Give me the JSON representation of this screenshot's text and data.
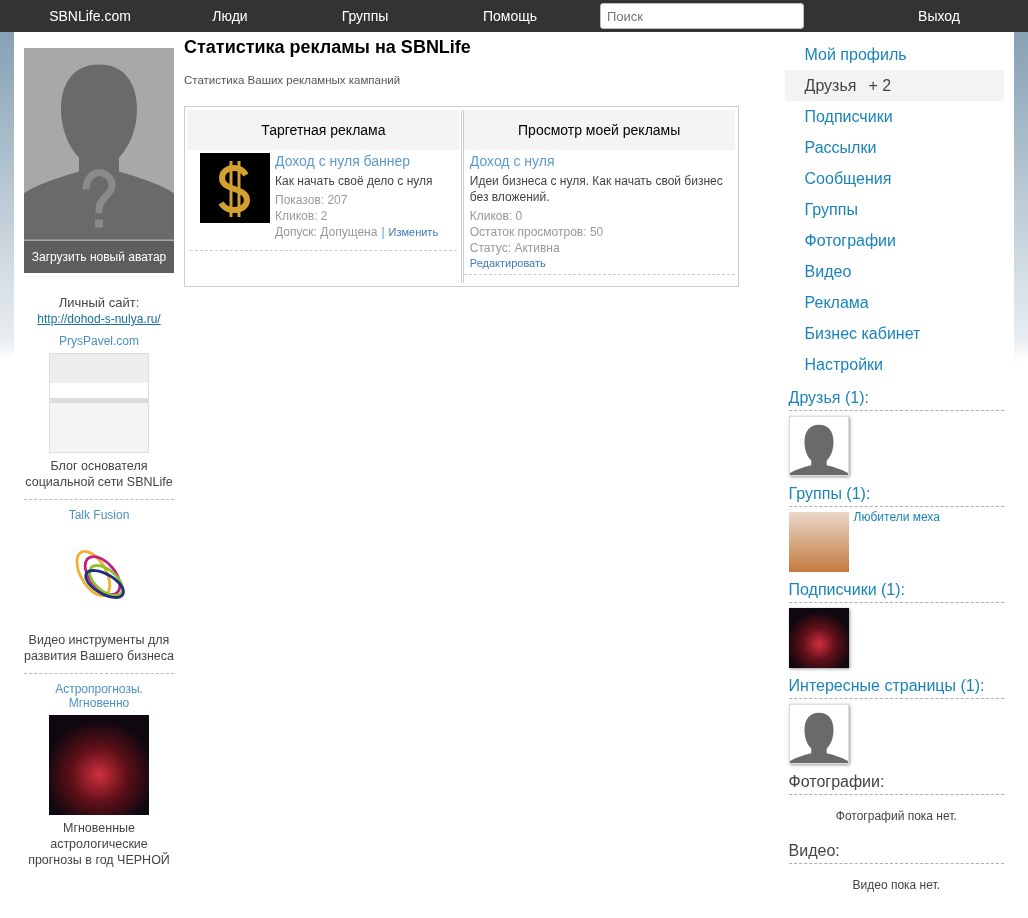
{
  "topbar": {
    "logo": "SBNLife.com",
    "links": [
      "Люди",
      "Группы",
      "Помощь"
    ],
    "search": {
      "placeholder": "Поиск"
    },
    "logout": "Выход"
  },
  "left": {
    "upload_avatar": "Загрузить новый аватар",
    "site_label": "Личный сайт:",
    "site_url": "http://dohod-s-nulya.ru/",
    "ads": [
      {
        "title": "PrysPavel.com",
        "kind": "screenshot",
        "text": "Блог основателя социальной сети SBNLife"
      },
      {
        "title": "Talk Fusion",
        "kind": "logo",
        "text": "Видео инструменты для развития Вашего бизнеса"
      },
      {
        "title": "Астропрогнозы. Мгновенно",
        "kind": "snake",
        "text": "Мгновенные астрологические прогнозы в год ЧЕРНОЙ"
      }
    ]
  },
  "main": {
    "title": "Статистика рекламы на SBNLife",
    "subtitle": "Статистика Ваших рекламных кампаний",
    "columns": [
      "Таргетная реклама",
      "Просмотр моей рекламы"
    ],
    "targeted": {
      "title": "Доход с нуля баннер",
      "description": "Как начать своё дело с нуля",
      "stats": [
        "Показов: 207",
        "Кликов: 2"
      ],
      "approval": "Допуск: Допущена",
      "separator": "|",
      "edit": "Изменить"
    },
    "mine": {
      "title": "Доход с нуля",
      "description": "Идеи бизнеса с нуля. Как начать свой бизнес без вложений.",
      "stats": [
        "Кликов: 0",
        "Остаток просмотров: 50",
        "Статус: Активна"
      ],
      "edit": "Редактировать"
    }
  },
  "right": {
    "menu": [
      {
        "label": "Мой профиль",
        "selected": false
      },
      {
        "label": "Друзья",
        "badge": "+ 2",
        "selected": true
      },
      {
        "label": "Подписчики",
        "selected": false
      },
      {
        "label": "Рассылки",
        "selected": false
      },
      {
        "label": "Сообщения",
        "selected": false
      },
      {
        "label": "Группы",
        "selected": false
      },
      {
        "label": "Фотографии",
        "selected": false
      },
      {
        "label": "Видео",
        "selected": false
      },
      {
        "label": "Реклама",
        "selected": false
      },
      {
        "label": "Бизнес кабинет",
        "selected": false
      },
      {
        "label": "Настройки",
        "selected": false
      }
    ],
    "sections": [
      {
        "heading": "Друзья (1):",
        "kind": "avatar"
      },
      {
        "heading": "Группы (1):",
        "kind": "group",
        "caption": "Любители меха"
      },
      {
        "heading": "Подписчики (1):",
        "kind": "snake"
      },
      {
        "heading": "Интересные страницы (1):",
        "kind": "avatar"
      },
      {
        "heading": "Фотографии:",
        "kind": "empty",
        "caption": "Фотографий пока нет."
      },
      {
        "heading": "Видео:",
        "kind": "empty",
        "caption": "Видео пока нет."
      }
    ]
  }
}
